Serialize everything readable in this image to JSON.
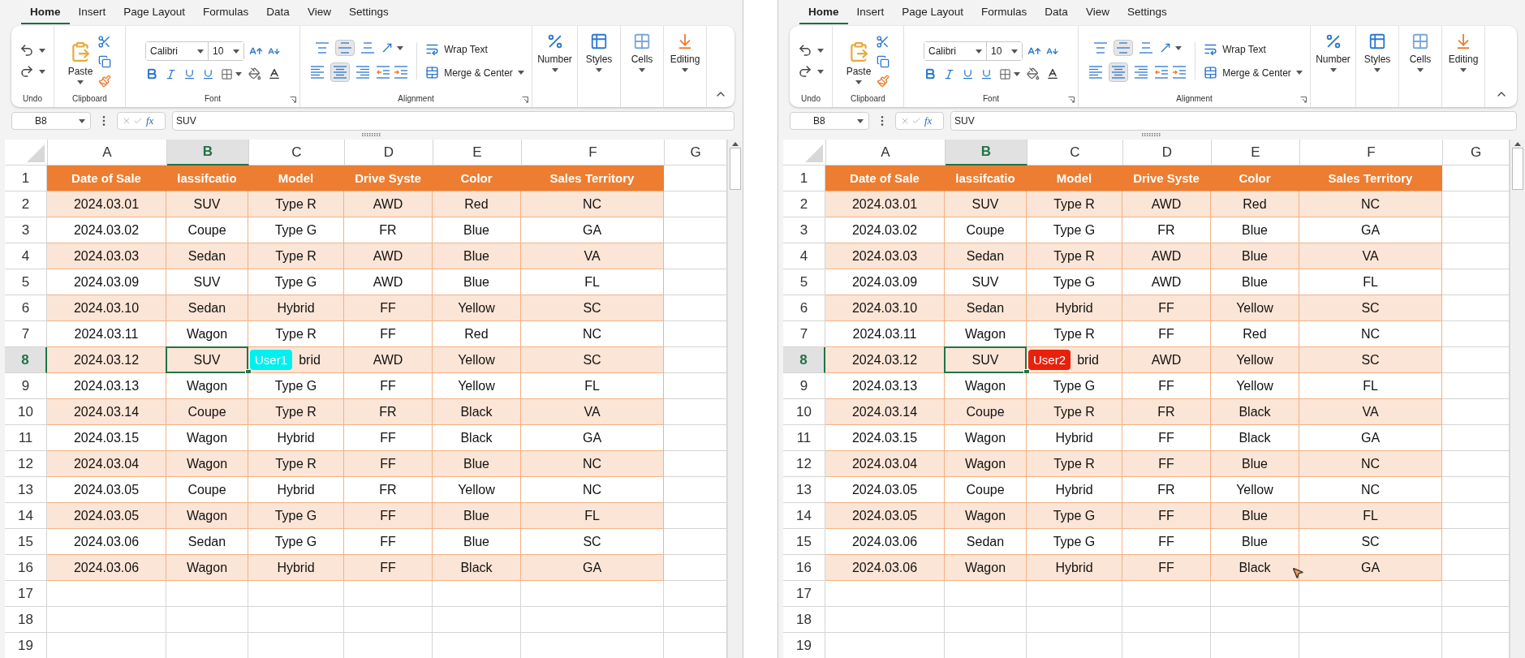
{
  "panes": [
    {
      "tabs": [
        {
          "label": "Home",
          "selected": true
        },
        {
          "label": "Insert",
          "selected": false
        },
        {
          "label": "Page Layout",
          "selected": false
        },
        {
          "label": "Formulas",
          "selected": false
        },
        {
          "label": "Data",
          "selected": false
        },
        {
          "label": "View",
          "selected": false
        },
        {
          "label": "Settings",
          "selected": false
        }
      ],
      "ribbon": {
        "undo_label": "Undo",
        "clipboard_label": "Clipboard",
        "paste": "Paste",
        "font_name": "Calibri",
        "font_size": "10",
        "font_label": "Font",
        "vertical_align": [
          {
            "kind": "top",
            "selected": false
          },
          {
            "kind": "middle",
            "selected": true
          },
          {
            "kind": "bottom",
            "selected": false
          }
        ],
        "horizontal_align": [
          {
            "kind": "left",
            "selected": false
          },
          {
            "kind": "center",
            "selected": true
          },
          {
            "kind": "right",
            "selected": false
          }
        ],
        "wrap_text": "Wrap Text",
        "merge": "Merge & Center",
        "alignment_label": "Alignment",
        "big_buttons": [
          {
            "kind": "number",
            "label": "Number"
          },
          {
            "kind": "styles",
            "label": "Styles"
          },
          {
            "kind": "cells",
            "label": "Cells"
          },
          {
            "kind": "editing",
            "label": "Editing"
          }
        ]
      },
      "name_box": "B8",
      "fx": "fx",
      "formula": "SUV",
      "columns": [
        {
          "label": "A",
          "selected": false
        },
        {
          "label": "B",
          "selected": true
        },
        {
          "label": "C",
          "selected": false
        },
        {
          "label": "D",
          "selected": false
        },
        {
          "label": "E",
          "selected": false
        },
        {
          "label": "F",
          "selected": false
        },
        {
          "label": "G",
          "selected": false
        }
      ],
      "header_row": {
        "header": "1",
        "selected": false,
        "cells": [
          "Date of Sale",
          "lassifcatio",
          "Model",
          "Drive Syste",
          "Color",
          "Sales Territory"
        ]
      },
      "rows": [
        {
          "header": "2",
          "selected": false,
          "shaded": true,
          "cells": [
            "2024.03.01",
            "SUV",
            "Type R",
            "AWD",
            "Red",
            "NC"
          ]
        },
        {
          "header": "3",
          "selected": false,
          "shaded": false,
          "cells": [
            "2024.03.02",
            "Coupe",
            "Type G",
            "FR",
            "Blue",
            "GA"
          ]
        },
        {
          "header": "4",
          "selected": false,
          "shaded": true,
          "cells": [
            "2024.03.03",
            "Sedan",
            "Type R",
            "AWD",
            "Blue",
            "VA"
          ]
        },
        {
          "header": "5",
          "selected": false,
          "shaded": false,
          "cells": [
            "2024.03.09",
            "SUV",
            "Type G",
            "AWD",
            "Blue",
            "FL"
          ]
        },
        {
          "header": "6",
          "selected": false,
          "shaded": true,
          "cells": [
            "2024.03.10",
            "Sedan",
            "Hybrid",
            "FF",
            "Yellow",
            "SC"
          ]
        },
        {
          "header": "7",
          "selected": false,
          "shaded": false,
          "cells": [
            "2024.03.11",
            "Wagon",
            "Type R",
            "FF",
            "Red",
            "NC"
          ]
        },
        {
          "header": "8",
          "selected": true,
          "shaded": true,
          "cells": [
            "2024.03.12",
            "SUV",
            "brid",
            "AWD",
            "Yellow",
            "SC"
          ]
        },
        {
          "header": "9",
          "selected": false,
          "shaded": false,
          "cells": [
            "2024.03.13",
            "Wagon",
            "Type G",
            "FF",
            "Yellow",
            "FL"
          ]
        },
        {
          "header": "10",
          "selected": false,
          "shaded": true,
          "cells": [
            "2024.03.14",
            "Coupe",
            "Type R",
            "FR",
            "Black",
            "VA"
          ]
        },
        {
          "header": "11",
          "selected": false,
          "shaded": false,
          "cells": [
            "2024.03.15",
            "Wagon",
            "Hybrid",
            "FF",
            "Black",
            "GA"
          ]
        },
        {
          "header": "12",
          "selected": false,
          "shaded": true,
          "cells": [
            "2024.03.04",
            "Wagon",
            "Type R",
            "FF",
            "Blue",
            "NC"
          ]
        },
        {
          "header": "13",
          "selected": false,
          "shaded": false,
          "cells": [
            "2024.03.05",
            "Coupe",
            "Hybrid",
            "FR",
            "Yellow",
            "NC"
          ]
        },
        {
          "header": "14",
          "selected": false,
          "shaded": true,
          "cells": [
            "2024.03.05",
            "Wagon",
            "Type G",
            "FF",
            "Blue",
            "FL"
          ]
        },
        {
          "header": "15",
          "selected": false,
          "shaded": false,
          "cells": [
            "2024.03.06",
            "Sedan",
            "Type G",
            "FF",
            "Blue",
            "SC"
          ]
        },
        {
          "header": "16",
          "selected": false,
          "shaded": true,
          "cells": [
            "2024.03.06",
            "Wagon",
            "Hybrid",
            "FF",
            "Black",
            "GA"
          ]
        },
        {
          "header": "17",
          "selected": false,
          "shaded": false
        },
        {
          "header": "18",
          "selected": false,
          "shaded": false
        },
        {
          "header": "19",
          "selected": false,
          "shaded": false
        }
      ],
      "user_badge": {
        "label": "User1",
        "color": "#00f0f0"
      }
    },
    {
      "tabs": [
        {
          "label": "Home",
          "selected": true
        },
        {
          "label": "Insert",
          "selected": false
        },
        {
          "label": "Page Layout",
          "selected": false
        },
        {
          "label": "Formulas",
          "selected": false
        },
        {
          "label": "Data",
          "selected": false
        },
        {
          "label": "View",
          "selected": false
        },
        {
          "label": "Settings",
          "selected": false
        }
      ],
      "ribbon": {
        "undo_label": "Undo",
        "clipboard_label": "Clipboard",
        "paste": "Paste",
        "font_name": "Calibri",
        "font_size": "10",
        "font_label": "Font",
        "vertical_align": [
          {
            "kind": "top",
            "selected": false
          },
          {
            "kind": "middle",
            "selected": true
          },
          {
            "kind": "bottom",
            "selected": false
          }
        ],
        "horizontal_align": [
          {
            "kind": "left",
            "selected": false
          },
          {
            "kind": "center",
            "selected": true
          },
          {
            "kind": "right",
            "selected": false
          }
        ],
        "wrap_text": "Wrap Text",
        "merge": "Merge & Center",
        "alignment_label": "Alignment",
        "big_buttons": [
          {
            "kind": "number",
            "label": "Number"
          },
          {
            "kind": "styles",
            "label": "Styles"
          },
          {
            "kind": "cells",
            "label": "Cells"
          },
          {
            "kind": "editing",
            "label": "Editing"
          }
        ]
      },
      "name_box": "B8",
      "fx": "fx",
      "formula": "SUV",
      "columns": [
        {
          "label": "A",
          "selected": false
        },
        {
          "label": "B",
          "selected": true
        },
        {
          "label": "C",
          "selected": false
        },
        {
          "label": "D",
          "selected": false
        },
        {
          "label": "E",
          "selected": false
        },
        {
          "label": "F",
          "selected": false
        },
        {
          "label": "G",
          "selected": false
        }
      ],
      "header_row": {
        "header": "1",
        "selected": false,
        "cells": [
          "Date of Sale",
          "lassifcatio",
          "Model",
          "Drive Syste",
          "Color",
          "Sales Territory"
        ]
      },
      "rows": [
        {
          "header": "2",
          "selected": false,
          "shaded": true,
          "cells": [
            "2024.03.01",
            "SUV",
            "Type R",
            "AWD",
            "Red",
            "NC"
          ]
        },
        {
          "header": "3",
          "selected": false,
          "shaded": false,
          "cells": [
            "2024.03.02",
            "Coupe",
            "Type G",
            "FR",
            "Blue",
            "GA"
          ]
        },
        {
          "header": "4",
          "selected": false,
          "shaded": true,
          "cells": [
            "2024.03.03",
            "Sedan",
            "Type R",
            "AWD",
            "Blue",
            "VA"
          ]
        },
        {
          "header": "5",
          "selected": false,
          "shaded": false,
          "cells": [
            "2024.03.09",
            "SUV",
            "Type G",
            "AWD",
            "Blue",
            "FL"
          ]
        },
        {
          "header": "6",
          "selected": false,
          "shaded": true,
          "cells": [
            "2024.03.10",
            "Sedan",
            "Hybrid",
            "FF",
            "Yellow",
            "SC"
          ]
        },
        {
          "header": "7",
          "selected": false,
          "shaded": false,
          "cells": [
            "2024.03.11",
            "Wagon",
            "Type R",
            "FF",
            "Red",
            "NC"
          ]
        },
        {
          "header": "8",
          "selected": true,
          "shaded": true,
          "cells": [
            "2024.03.12",
            "SUV",
            "brid",
            "AWD",
            "Yellow",
            "SC"
          ]
        },
        {
          "header": "9",
          "selected": false,
          "shaded": false,
          "cells": [
            "2024.03.13",
            "Wagon",
            "Type G",
            "FF",
            "Yellow",
            "FL"
          ]
        },
        {
          "header": "10",
          "selected": false,
          "shaded": true,
          "cells": [
            "2024.03.14",
            "Coupe",
            "Type R",
            "FR",
            "Black",
            "VA"
          ]
        },
        {
          "header": "11",
          "selected": false,
          "shaded": false,
          "cells": [
            "2024.03.15",
            "Wagon",
            "Hybrid",
            "FF",
            "Black",
            "GA"
          ]
        },
        {
          "header": "12",
          "selected": false,
          "shaded": true,
          "cells": [
            "2024.03.04",
            "Wagon",
            "Type R",
            "FF",
            "Blue",
            "NC"
          ]
        },
        {
          "header": "13",
          "selected": false,
          "shaded": false,
          "cells": [
            "2024.03.05",
            "Coupe",
            "Hybrid",
            "FR",
            "Yellow",
            "NC"
          ]
        },
        {
          "header": "14",
          "selected": false,
          "shaded": true,
          "cells": [
            "2024.03.05",
            "Wagon",
            "Type G",
            "FF",
            "Blue",
            "FL"
          ]
        },
        {
          "header": "15",
          "selected": false,
          "shaded": false,
          "cells": [
            "2024.03.06",
            "Sedan",
            "Type G",
            "FF",
            "Blue",
            "SC"
          ]
        },
        {
          "header": "16",
          "selected": false,
          "shaded": true,
          "cells": [
            "2024.03.06",
            "Wagon",
            "Hybrid",
            "FF",
            "Black",
            "GA"
          ]
        },
        {
          "header": "17",
          "selected": false,
          "shaded": false
        },
        {
          "header": "18",
          "selected": false,
          "shaded": false
        },
        {
          "header": "19",
          "selected": false,
          "shaded": false
        }
      ],
      "user_badge": {
        "label": "User2",
        "color": "#e8200c"
      },
      "mouse_pointer": true
    }
  ]
}
